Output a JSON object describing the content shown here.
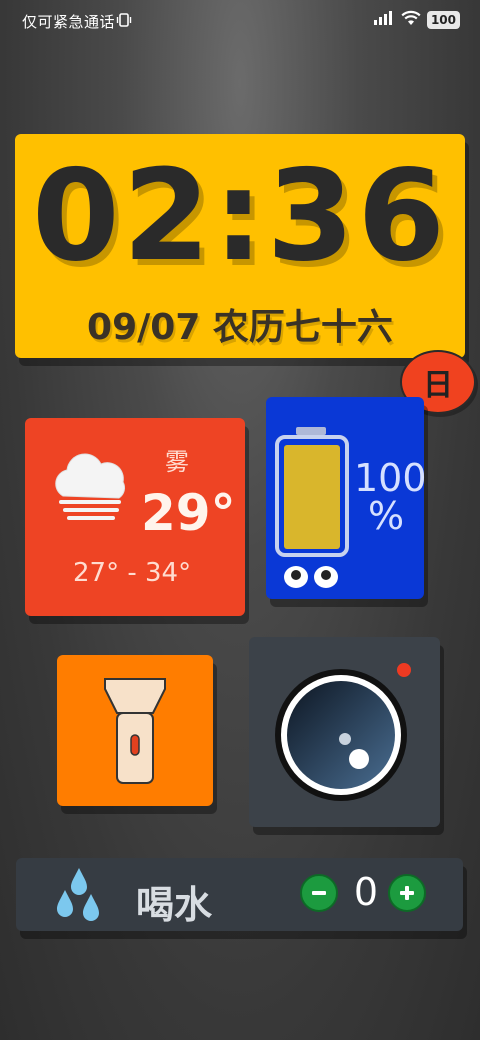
{
  "status_bar": {
    "network_text": "仅可紧急通话",
    "battery_level": "100"
  },
  "clock_widget": {
    "time": "02:36",
    "date": "09/07 农历七十六",
    "weekday_badge": "日"
  },
  "weather_widget": {
    "condition": "雾",
    "temperature": "29°",
    "range": "27° - 34°",
    "icon": "fog-cloud-icon"
  },
  "battery_widget": {
    "percent_value": "100",
    "percent_sign": "%",
    "level_fraction": 1.0
  },
  "flashlight_widget": {
    "icon": "flashlight-icon"
  },
  "camera_widget": {
    "icon": "camera-lens-icon"
  },
  "water_widget": {
    "label": "喝水",
    "count": "0",
    "icon": "water-drops-icon"
  },
  "colors": {
    "clock_bg": "#ffc000",
    "weather_bg": "#ee4424",
    "battery_bg": "#0a38d6",
    "flash_bg": "#ff7d00",
    "camera_bg": "#3c4249",
    "water_bg": "#363c43",
    "accent_green": "#1c9b3f"
  }
}
